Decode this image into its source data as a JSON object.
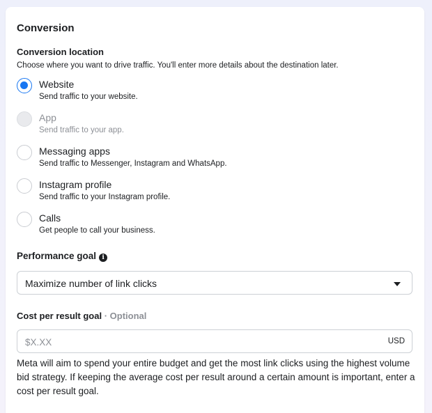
{
  "conversion": {
    "title": "Conversion",
    "location_title": "Conversion location",
    "location_description": "Choose where you want to drive traffic. You'll enter more details about the destination later.",
    "options": [
      {
        "label": "Website",
        "description": "Send traffic to your website.",
        "state": "selected"
      },
      {
        "label": "App",
        "description": "Send traffic to your app.",
        "state": "disabled"
      },
      {
        "label": "Messaging apps",
        "description": "Send traffic to Messenger, Instagram and WhatsApp.",
        "state": "unselected"
      },
      {
        "label": "Instagram profile",
        "description": "Send traffic to your Instagram profile.",
        "state": "unselected"
      },
      {
        "label": "Calls",
        "description": "Get people to call your business.",
        "state": "unselected"
      }
    ]
  },
  "performance_goal": {
    "title": "Performance goal",
    "info_icon": "info-circle-icon",
    "selected": "Maximize number of link clicks"
  },
  "cost_per_result": {
    "title": "Cost per result goal",
    "optional_label": "· Optional",
    "placeholder": "$X.XX",
    "currency": "USD",
    "help_text": "Meta will aim to spend your entire budget and get the most link clicks using the highest volume bid strategy. If keeping the average cost per result around a certain amount is important, enter a cost per result goal."
  },
  "colors": {
    "accent": "#1877f2",
    "muted": "#8d9096",
    "text": "#1c1e21"
  }
}
